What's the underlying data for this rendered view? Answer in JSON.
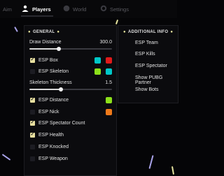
{
  "tabs": [
    {
      "label": "Aim",
      "icon": "aim-icon"
    },
    {
      "label": "Players",
      "icon": "players-icon"
    },
    {
      "label": "World",
      "icon": "world-icon"
    },
    {
      "label": "Settings",
      "icon": "settings-icon"
    }
  ],
  "general": {
    "header": "GENERAL",
    "draw_distance": {
      "label": "Draw Distance",
      "value": "300.0",
      "fraction": 0.3
    },
    "esp_box": {
      "label": "ESP Box",
      "checked": true,
      "colors": [
        "#00c8c8",
        "#e01a1a"
      ]
    },
    "esp_skeleton": {
      "label": "ESP Skeleton",
      "checked": false,
      "colors": [
        "#8ce01a",
        "#00c8c8"
      ]
    },
    "skeleton_thickness": {
      "label": "Skeleton Thickness",
      "value": "1.5",
      "fraction": 0.42
    },
    "esp_distance": {
      "label": "ESP Distance",
      "checked": true,
      "color": "#8ce01a"
    },
    "esp_nick": {
      "label": "ESP Nick",
      "checked": false,
      "color": "#f07a1a"
    },
    "esp_spectator_count": {
      "label": "ESP Spectator Count",
      "checked": true
    },
    "esp_health": {
      "label": "ESP Health",
      "checked": true
    },
    "esp_knocked": {
      "label": "ESP Knocked",
      "checked": false
    },
    "esp_weapon": {
      "label": "ESP Weapon",
      "checked": false
    }
  },
  "additional": {
    "header": "ADDITIONAL INFO",
    "items": [
      "ESP Team",
      "ESP Kills",
      "ESP Spectator",
      "Show PUBG Partner",
      "Show Bots"
    ]
  },
  "accent": "#e8e0a0"
}
